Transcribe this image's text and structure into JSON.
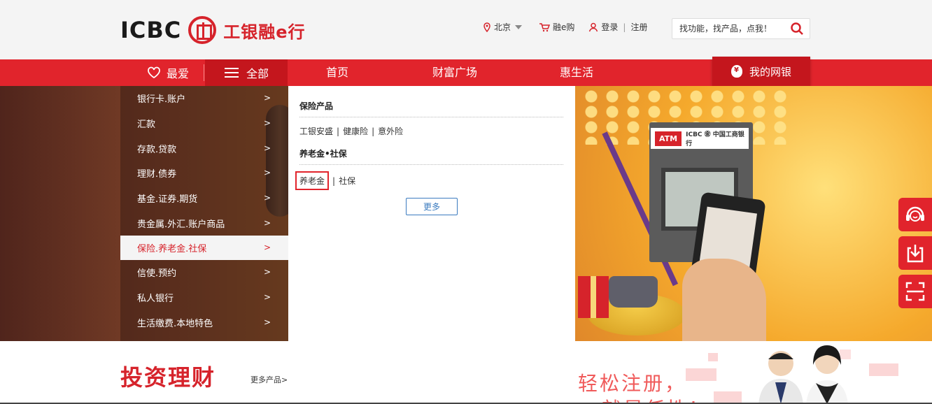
{
  "header": {
    "logo_text": "ICBC",
    "logo_cn": "工银融e行",
    "location": "北京",
    "shop": "融e购",
    "login": "登录",
    "register": "注册",
    "search_placeholder": "找功能，找产品，点我！"
  },
  "nav": {
    "favorites": "最爱",
    "all": "全部",
    "items": [
      "首页",
      "财富广场",
      "惠生活"
    ],
    "my_bank": "我的网银"
  },
  "categories": [
    {
      "label": "银行卡.账户",
      "arrow": ">"
    },
    {
      "label": "汇款",
      "arrow": ">"
    },
    {
      "label": "存款.贷款",
      "arrow": ">"
    },
    {
      "label": "理财.债券",
      "arrow": ">"
    },
    {
      "label": "基金.证券.期货",
      "arrow": ">"
    },
    {
      "label": "贵金属.外汇.账户商品",
      "arrow": ">"
    },
    {
      "label": "保险.养老金.社保",
      "arrow": ">"
    },
    {
      "label": "信使.预约",
      "arrow": ">"
    },
    {
      "label": "私人银行",
      "arrow": ">"
    },
    {
      "label": "生活缴费.本地特色",
      "arrow": ">"
    }
  ],
  "panel": {
    "section1_title": "保险产品",
    "section1_links": [
      "工银安盛",
      "健康险",
      "意外险"
    ],
    "section2_title": "养老金•社保",
    "section2_links": [
      "养老金",
      "社保"
    ],
    "more": "更多"
  },
  "hero": {
    "atm_label": "ATM",
    "atm_brand": "ICBC ㊎ 中国工商银行"
  },
  "bottom": {
    "invest_title": "投资理财",
    "more_products": "更多产品>",
    "banner_line1": "轻松注册，",
    "banner_line2": "就是任性！"
  },
  "colors": {
    "brand_red": "#e1242c",
    "dark_red": "#c4161d",
    "link_blue": "#3b7bbf"
  }
}
